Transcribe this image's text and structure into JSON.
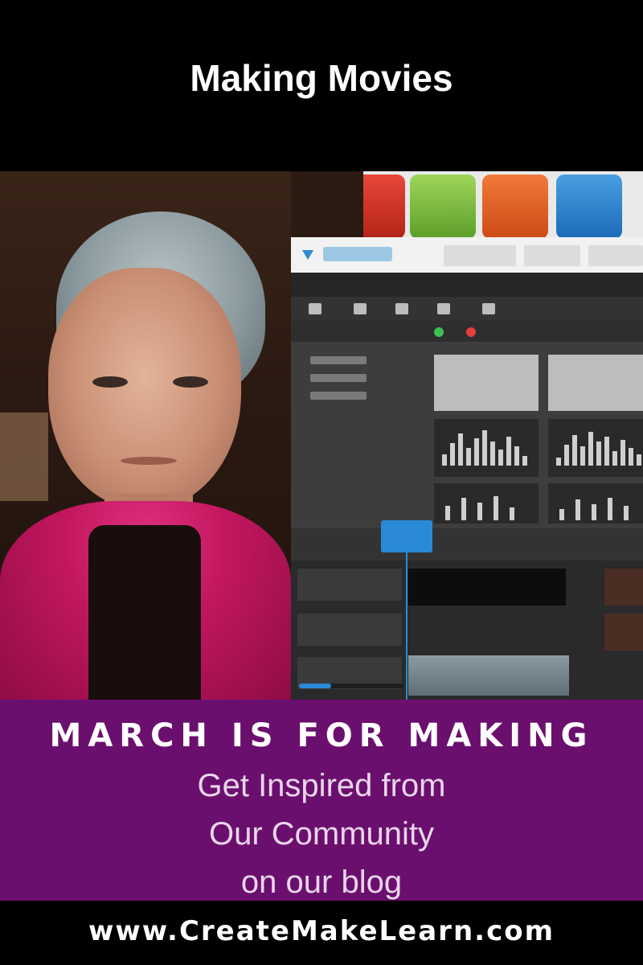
{
  "header": {
    "title": "Making Movies"
  },
  "banner": {
    "headline": "MARCH IS FOR MAKING",
    "lines": [
      "Get Inspired from",
      "Our Community",
      "on our blog"
    ]
  },
  "footer": {
    "url": "www.CreateMakeLearn.com"
  },
  "colors": {
    "purple_band": "#6b0f6e",
    "black_band": "#000000",
    "scarf": "#c2175e",
    "app_accent": "#2a8ad8"
  }
}
